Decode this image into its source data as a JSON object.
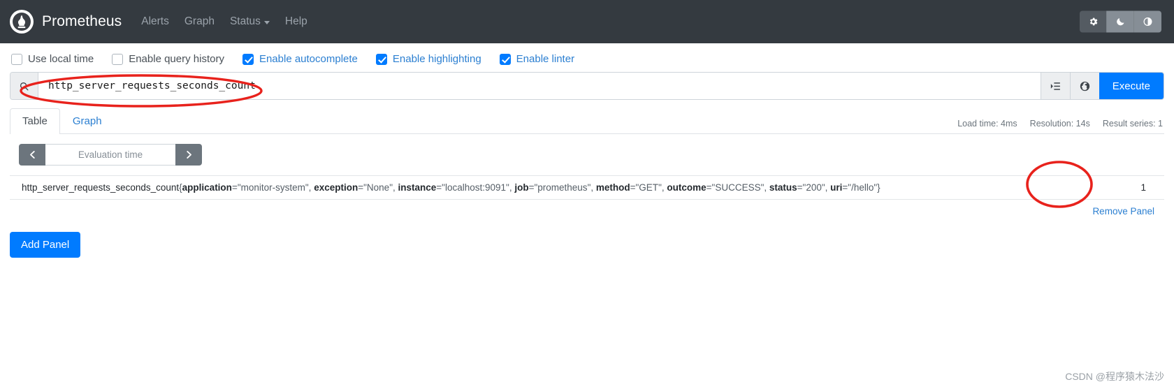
{
  "navbar": {
    "brand": "Prometheus",
    "logo_icon": "prometheus-logo-icon",
    "links": [
      {
        "label": "Alerts",
        "name": "nav-link-alerts",
        "caret": false
      },
      {
        "label": "Graph",
        "name": "nav-link-graph",
        "caret": false
      },
      {
        "label": "Status",
        "name": "nav-link-status",
        "caret": true
      },
      {
        "label": "Help",
        "name": "nav-link-help",
        "caret": false
      }
    ],
    "theme_buttons": [
      {
        "icon": "gear-icon",
        "name": "theme-settings-button",
        "active": true
      },
      {
        "icon": "moon-icon",
        "name": "theme-dark-button",
        "active": false
      },
      {
        "icon": "contrast-icon",
        "name": "theme-auto-button",
        "active": false
      }
    ]
  },
  "options": [
    {
      "label": "Use local time",
      "checked": false,
      "name": "checkbox-use-local-time"
    },
    {
      "label": "Enable query history",
      "checked": false,
      "name": "checkbox-enable-query-history"
    },
    {
      "label": "Enable autocomplete",
      "checked": true,
      "name": "checkbox-enable-autocomplete"
    },
    {
      "label": "Enable highlighting",
      "checked": true,
      "name": "checkbox-enable-highlighting"
    },
    {
      "label": "Enable linter",
      "checked": true,
      "name": "checkbox-enable-linter"
    }
  ],
  "query": {
    "value": "http_server_requests_seconds_count",
    "placeholder": "Expression (press Shift+Enter for newlines)",
    "search_icon": "search-icon",
    "metrics_explorer_icon": "metrics-explorer-icon",
    "globe_icon": "globe-icon",
    "execute_label": "Execute"
  },
  "panel": {
    "tabs": [
      {
        "label": "Table",
        "active": true,
        "name": "tab-table"
      },
      {
        "label": "Graph",
        "active": false,
        "name": "tab-graph"
      }
    ],
    "meta": {
      "load_time": "Load time: 4ms",
      "resolution": "Resolution: 14s",
      "result_series": "Result series: 1"
    },
    "evaluation": {
      "prev_icon": "chevron-left-icon",
      "next_icon": "chevron-right-icon",
      "placeholder": "Evaluation time",
      "value": ""
    },
    "result": {
      "metric_name": "http_server_requests_seconds_count",
      "labels": [
        {
          "key": "application",
          "value": "monitor-system"
        },
        {
          "key": "exception",
          "value": "None"
        },
        {
          "key": "instance",
          "value": "localhost:9091"
        },
        {
          "key": "job",
          "value": "prometheus"
        },
        {
          "key": "method",
          "value": "GET"
        },
        {
          "key": "outcome",
          "value": "SUCCESS"
        },
        {
          "key": "status",
          "value": "200"
        },
        {
          "key": "uri",
          "value": "/hello"
        }
      ],
      "value": "1"
    },
    "remove_panel_label": "Remove Panel"
  },
  "add_panel_label": "Add Panel",
  "watermark": "CSDN @程序猿木法沙",
  "colors": {
    "navbar_bg": "#343a40",
    "accent_blue": "#007bff",
    "link_blue": "#2b7fd1",
    "muted": "#6c757d",
    "annotation_red": "#e8221c"
  }
}
